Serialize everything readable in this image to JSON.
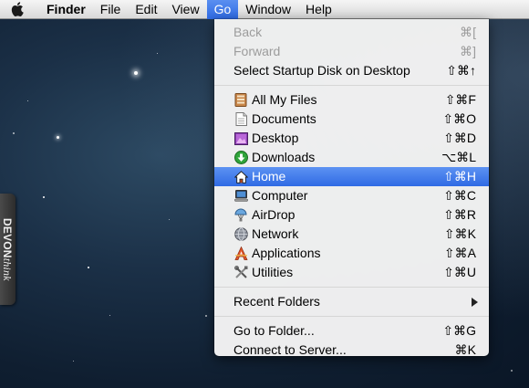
{
  "menubar": {
    "apple_icon": "apple-logo-icon",
    "menus": [
      {
        "label": "Finder",
        "bold": true
      },
      {
        "label": "File"
      },
      {
        "label": "Edit"
      },
      {
        "label": "View"
      },
      {
        "label": "Go",
        "active": true
      },
      {
        "label": "Window"
      },
      {
        "label": "Help"
      }
    ]
  },
  "go_menu": {
    "items": [
      {
        "label": "Back",
        "shortcut": "⌘[",
        "disabled": true
      },
      {
        "label": "Forward",
        "shortcut": "⌘]",
        "disabled": true
      },
      {
        "label": "Select Startup Disk on Desktop",
        "shortcut": "⇧⌘↑"
      },
      {
        "label": "All My Files",
        "shortcut": "⇧⌘F",
        "icon": "all-my-files-icon"
      },
      {
        "label": "Documents",
        "shortcut": "⇧⌘O",
        "icon": "documents-icon"
      },
      {
        "label": "Desktop",
        "shortcut": "⇧⌘D",
        "icon": "desktop-icon"
      },
      {
        "label": "Downloads",
        "shortcut": "⌥⌘L",
        "icon": "downloads-icon"
      },
      {
        "label": "Home",
        "shortcut": "⇧⌘H",
        "icon": "home-icon",
        "selected": true
      },
      {
        "label": "Computer",
        "shortcut": "⇧⌘C",
        "icon": "computer-icon"
      },
      {
        "label": "AirDrop",
        "shortcut": "⇧⌘R",
        "icon": "airdrop-icon"
      },
      {
        "label": "Network",
        "shortcut": "⇧⌘K",
        "icon": "network-icon"
      },
      {
        "label": "Applications",
        "shortcut": "⇧⌘A",
        "icon": "applications-icon"
      },
      {
        "label": "Utilities",
        "shortcut": "⇧⌘U",
        "icon": "utilities-icon"
      },
      {
        "label": "Recent Folders",
        "submenu": true
      },
      {
        "label": "Go to Folder...",
        "shortcut": "⇧⌘G"
      },
      {
        "label": "Connect to Server...",
        "shortcut": "⌘K"
      }
    ]
  },
  "sidebar_tab": {
    "brand_bold": "DEVON",
    "brand_italic": "think"
  },
  "colors": {
    "highlight": "#3a75e8",
    "menubar": "#e6e6e6",
    "desktop": "#1b3047"
  }
}
